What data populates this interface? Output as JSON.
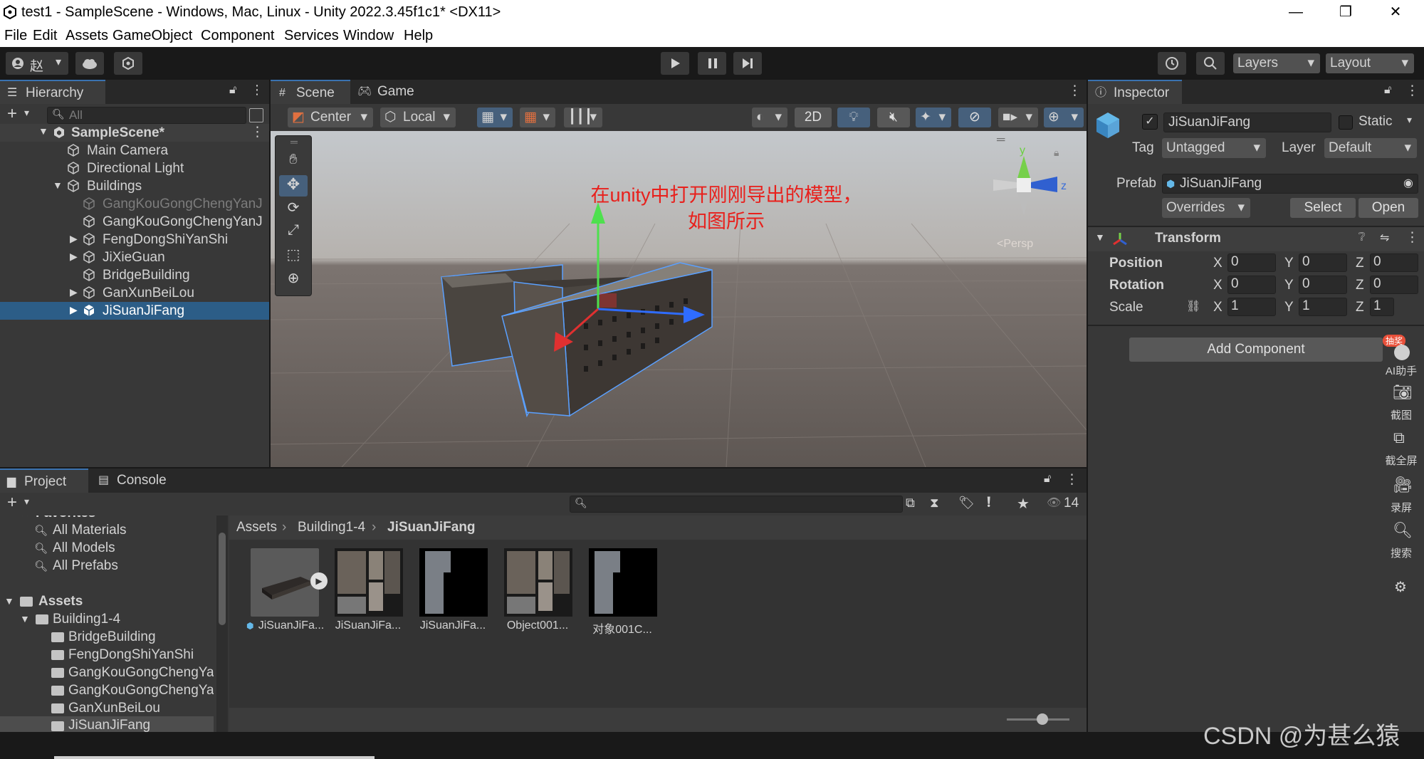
{
  "window": {
    "title": "test1 - SampleScene - Windows, Mac, Linux - Unity 2022.3.45f1c1* <DX11>",
    "minimize": "—",
    "restore": "❐",
    "close": "✕"
  },
  "menu": [
    "File",
    "Edit",
    "Assets",
    "GameObject",
    "Component",
    "Services",
    "Window",
    "Help"
  ],
  "toolbar": {
    "account": "赵",
    "layers": "Layers",
    "layout": "Layout"
  },
  "hierarchy": {
    "tab": "Hierarchy",
    "search_placeholder": "All",
    "scene": "SampleScene*",
    "items": [
      {
        "label": "Main Camera"
      },
      {
        "label": "Directional Light"
      },
      {
        "label": "Buildings"
      },
      {
        "label": "GangKouGongChengYanJ"
      },
      {
        "label": "GangKouGongChengYanJ"
      },
      {
        "label": "FengDongShiYanShi"
      },
      {
        "label": "JiXieGuan"
      },
      {
        "label": "BridgeBuilding"
      },
      {
        "label": "GanXunBeiLou"
      },
      {
        "label": "JiSuanJiFang"
      }
    ]
  },
  "scene": {
    "tabs": [
      "Scene",
      "Game"
    ],
    "pivot": "Center",
    "space": "Local",
    "mode2d": "2D",
    "annotation_line1": "在unity中打开刚刚导出的模型，",
    "annotation_line2": "如图所示",
    "gizmo_y": "y",
    "gizmo_z": "z",
    "persp": "<Persp"
  },
  "inspector": {
    "tab": "Inspector",
    "object_name": "JiSuanJiFang",
    "static": "Static",
    "tag_label": "Tag",
    "tag_value": "Untagged",
    "layer_label": "Layer",
    "layer_value": "Default",
    "prefab_label": "Prefab",
    "prefab_value": "JiSuanJiFang",
    "overrides": "Overrides",
    "select": "Select",
    "open": "Open",
    "transform": "Transform",
    "position": "Position",
    "rotation": "Rotation",
    "scale": "Scale",
    "axis_x": "X",
    "axis_y": "Y",
    "axis_z": "Z",
    "pos": [
      "0",
      "0",
      "0"
    ],
    "rot": [
      "0",
      "0",
      "0"
    ],
    "scl": [
      "1",
      "1",
      "1"
    ],
    "add_component": "Add Component"
  },
  "sidebar_tools": [
    {
      "label": "AI助手",
      "badge": "抽奖"
    },
    {
      "label": "截图"
    },
    {
      "label": "截全屏"
    },
    {
      "label": "录屏"
    },
    {
      "label": "搜索"
    }
  ],
  "project": {
    "tabs": [
      "Project",
      "Console"
    ],
    "count": "14",
    "favorites": "Favorites",
    "fav_items": [
      "All Materials",
      "All Models",
      "All Prefabs"
    ],
    "assets": "Assets",
    "tree": [
      "Building1-4",
      "BridgeBuilding",
      "FengDongShiYanShi",
      "GangKouGongChengYa",
      "GangKouGongChengYa",
      "GanXunBeiLou",
      "JiSuanJiFang"
    ],
    "breadcrumb": [
      "Assets",
      "Building1-4",
      "JiSuanJiFang"
    ],
    "files": [
      "JiSuanJiFa...",
      "JiSuanJiFa...",
      "JiSuanJiFa...",
      "Object001...",
      "对象001C..."
    ]
  },
  "watermark": "CSDN @为甚么猿",
  "colors": {
    "selection": "#2c5d87",
    "accent": "#3a72b0",
    "annotation": "#e8201c"
  }
}
